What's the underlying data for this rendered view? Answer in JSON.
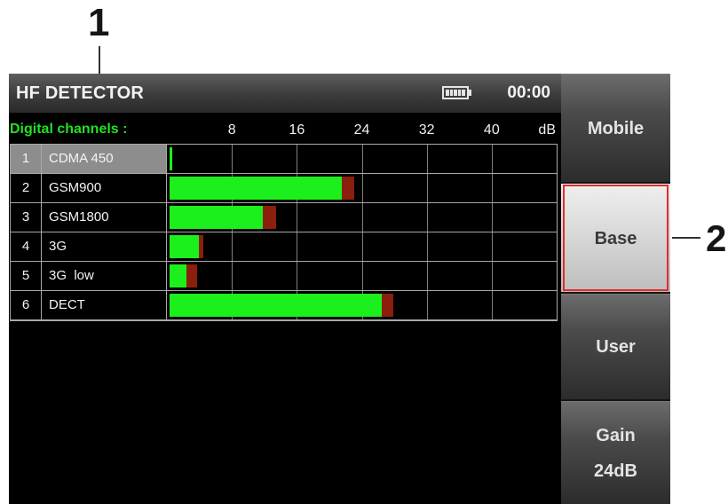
{
  "annotations": {
    "callout_1": "1",
    "callout_2": "2"
  },
  "header": {
    "title": "HF DETECTOR",
    "battery_icon": "battery-icon",
    "battery_level": 1.0,
    "time": "00:00"
  },
  "meter": {
    "section_label": "Digital channels :",
    "scale_ticks": [
      8,
      16,
      24,
      32,
      40
    ],
    "scale_unit": "dB",
    "scale_range": [
      0,
      48
    ]
  },
  "channels": [
    {
      "number": "1",
      "name": "CDMA 450",
      "level_db": 0.6,
      "peak_db": 0.6,
      "selected": true
    },
    {
      "number": "2",
      "name": "GSM900",
      "level_db": 21.5,
      "peak_db": 23.1,
      "selected": false
    },
    {
      "number": "3",
      "name": "GSM1800",
      "level_db": 11.8,
      "peak_db": 13.4,
      "selected": false
    },
    {
      "number": "4",
      "name": "3G",
      "level_db": 3.9,
      "peak_db": 4.5,
      "selected": false
    },
    {
      "number": "5",
      "name": "3G  low",
      "level_db": 2.4,
      "peak_db": 3.7,
      "selected": false
    },
    {
      "number": "6",
      "name": "DECT",
      "level_db": 26.5,
      "peak_db": 27.9,
      "selected": false
    }
  ],
  "side_menu": {
    "buttons": [
      {
        "label": "Mobile",
        "active": false
      },
      {
        "label": "Base",
        "active": true
      },
      {
        "label": "User",
        "active": false
      },
      {
        "label": "Gain",
        "value": "24dB",
        "active": false
      }
    ]
  },
  "colors": {
    "level_bar": "#1cf01c",
    "peak_marker": "#8b1e0c",
    "section_label": "#22e022",
    "selected_row": "#8d8d8d",
    "highlight_border": "#e32b2b"
  }
}
